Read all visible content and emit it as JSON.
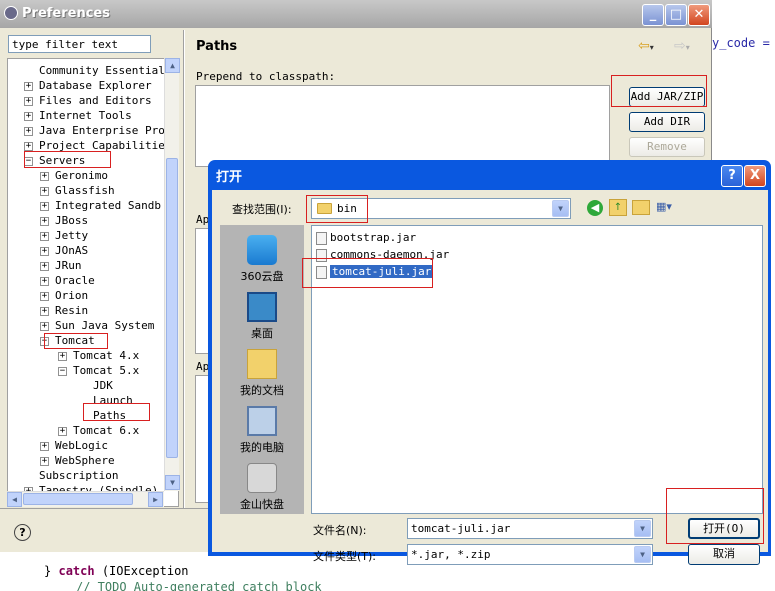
{
  "editor": {
    "top_code": "y_code =",
    "catch_keyword": "catch",
    "catch_rest": "(IOException",
    "catch_prefix": "}",
    "todo_comment": "// TODO Auto-generated catch block"
  },
  "preferences": {
    "title": "Preferences",
    "filter_placeholder": "type filter text",
    "page_title": "Paths",
    "prepend_label": "Prepend to classpath:",
    "ap_label_1": "Ap",
    "ap_label_2": "Ap",
    "buttons": {
      "add_jar": "Add JAR/ZIP",
      "add_dir": "Add DIR",
      "remove": "Remove"
    },
    "help_glyph": "?",
    "tree": [
      {
        "label": "Community Essential",
        "toggle": "",
        "level": 1
      },
      {
        "label": "Database Explorer",
        "toggle": "+",
        "level": 1
      },
      {
        "label": "Files and Editors",
        "toggle": "+",
        "level": 1
      },
      {
        "label": "Internet Tools",
        "toggle": "+",
        "level": 1
      },
      {
        "label": "Java Enterprise Pro",
        "toggle": "+",
        "level": 1
      },
      {
        "label": "Project Capabilitie",
        "toggle": "+",
        "level": 1
      },
      {
        "label": "Servers",
        "toggle": "-",
        "level": 1
      },
      {
        "label": "Geronimo",
        "toggle": "+",
        "level": 2
      },
      {
        "label": "Glassfish",
        "toggle": "+",
        "level": 2
      },
      {
        "label": "Integrated Sandb",
        "toggle": "+",
        "level": 2
      },
      {
        "label": "JBoss",
        "toggle": "+",
        "level": 2
      },
      {
        "label": "Jetty",
        "toggle": "+",
        "level": 2
      },
      {
        "label": "JOnAS",
        "toggle": "+",
        "level": 2
      },
      {
        "label": "JRun",
        "toggle": "+",
        "level": 2
      },
      {
        "label": "Oracle",
        "toggle": "+",
        "level": 2
      },
      {
        "label": "Orion",
        "toggle": "+",
        "level": 2
      },
      {
        "label": "Resin",
        "toggle": "+",
        "level": 2
      },
      {
        "label": "Sun Java System",
        "toggle": "+",
        "level": 2
      },
      {
        "label": "Tomcat",
        "toggle": "-",
        "level": 2
      },
      {
        "label": "Tomcat  4.x",
        "toggle": "+",
        "level": 3
      },
      {
        "label": "Tomcat  5.x",
        "toggle": "-",
        "level": 3
      },
      {
        "label": "JDK",
        "toggle": "",
        "level": 4
      },
      {
        "label": "Launch",
        "toggle": "",
        "level": 4
      },
      {
        "label": "Paths",
        "toggle": "",
        "level": 4
      },
      {
        "label": "Tomcat  6.x",
        "toggle": "+",
        "level": 3
      },
      {
        "label": "WebLogic",
        "toggle": "+",
        "level": 2
      },
      {
        "label": "WebSphere",
        "toggle": "+",
        "level": 2
      },
      {
        "label": "Subscription",
        "toggle": "",
        "level": 1
      },
      {
        "label": "Tapestry (Spindle)",
        "toggle": "+",
        "level": 1
      }
    ]
  },
  "open_dialog": {
    "title": "打开",
    "lookin_label": "查找范围(I):",
    "lookin_value": "bin",
    "places": [
      "360云盘",
      "桌面",
      "我的文档",
      "我的电脑",
      "金山快盘"
    ],
    "files": [
      "bootstrap.jar",
      "commons-daemon.jar",
      "tomcat-juli.jar"
    ],
    "filename_label": "文件名(N):",
    "filename_value": "tomcat-juli.jar",
    "filetype_label": "文件类型(T):",
    "filetype_value": "*.jar, *.zip",
    "open_button": "打开(O)",
    "cancel_button": "取消",
    "help_button": "?",
    "close_button": "X"
  },
  "colors": {
    "highlight_box": "#d82020",
    "dialog_title": "#0a58e0",
    "selection": "#316ac5"
  }
}
